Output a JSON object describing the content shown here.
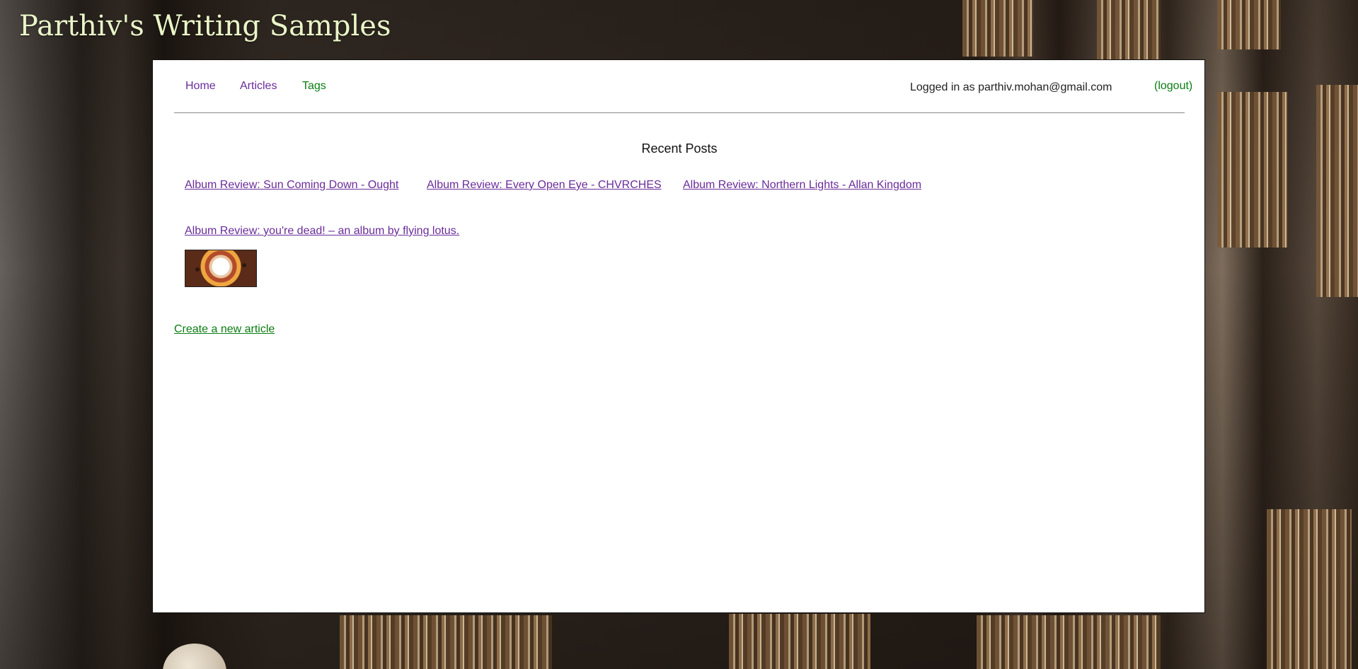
{
  "site": {
    "title": "Parthiv's Writing Samples"
  },
  "nav": {
    "home": "Home",
    "articles": "Articles",
    "tags": "Tags",
    "login_status": "Logged in as parthiv.mohan@gmail.com",
    "logout": "(logout)"
  },
  "recent": {
    "title": "Recent Posts",
    "posts": [
      "Album Review: Sun Coming Down - Ought",
      "Album Review: Every Open Eye - CHVRCHES",
      "Album Review: Northern Lights - Allan Kingdom",
      "Album Review: you're dead! – an album by flying lotus."
    ]
  },
  "actions": {
    "create_article": "Create a new article"
  },
  "colors": {
    "visited_link": "#6a2c9a",
    "active_link": "#0a7d12",
    "title": "#e9f5c8"
  },
  "icons": {
    "post_thumbnail": "album-art-image"
  }
}
